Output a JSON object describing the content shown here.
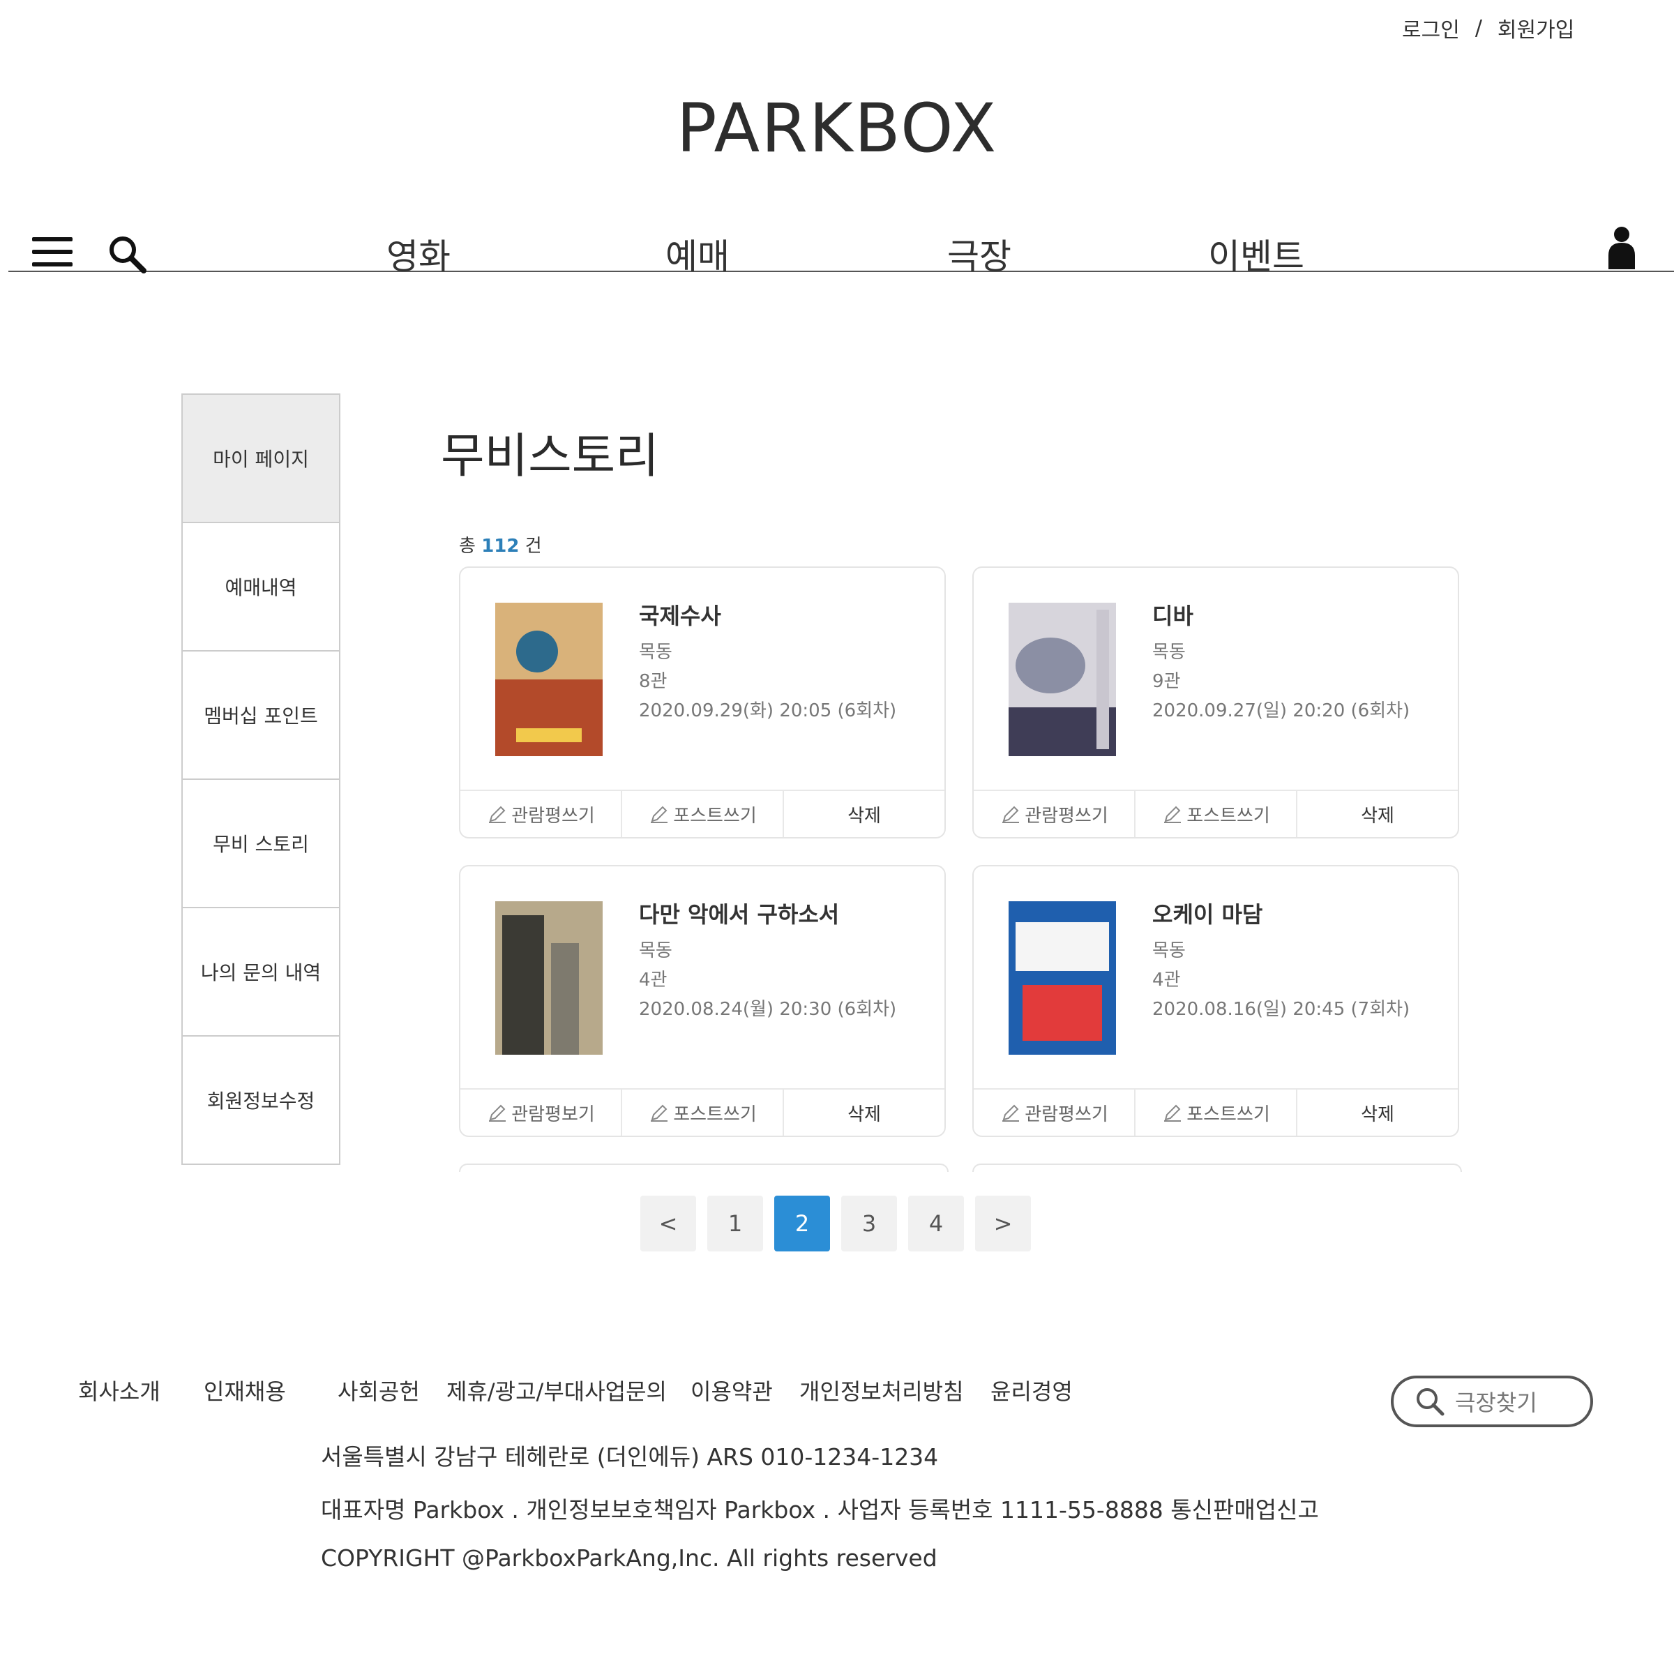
{
  "header": {
    "login": "로그인",
    "separator": "/",
    "signup": "회원가입",
    "logo": "PARKBOX"
  },
  "nav": {
    "items": [
      "영화",
      "예매",
      "극장",
      "이벤트"
    ],
    "icons": {
      "menu": "hamburger-menu-icon",
      "search": "search-icon",
      "user": "user-icon"
    }
  },
  "sidemenu": {
    "items": [
      "마이 페이지",
      "예매내역",
      "멤버십 포인트",
      "무비 스토리",
      "나의 문의 내역",
      "회원정보수정"
    ],
    "active_index": 0
  },
  "main": {
    "title": "무비스토리",
    "count_prefix": "총",
    "count": "112",
    "count_suffix": "건",
    "cards": [
      {
        "title": "국제수사",
        "location": "목동",
        "hall": "8관",
        "datetime": "2020.09.29(화) 20:05 (6회차)",
        "actions": [
          "관람평쓰기",
          "포스트쓰기",
          "삭제"
        ],
        "poster_colors": [
          "#d9b27a",
          "#b34a2a",
          "#2d6a8c"
        ]
      },
      {
        "title": "디바",
        "location": "목동",
        "hall": "9관",
        "datetime": "2020.09.27(일) 20:20 (6회차)",
        "actions": [
          "관람평쓰기",
          "포스트쓰기",
          "삭제"
        ],
        "poster_colors": [
          "#8b8fa4",
          "#3f3d56",
          "#d7d5dc"
        ]
      },
      {
        "title": "다만 악에서 구하소서",
        "location": "목동",
        "hall": "4관",
        "datetime": "2020.08.24(월) 20:30 (6회차)",
        "actions": [
          "관람평보기",
          "포스트쓰기",
          "삭제"
        ],
        "poster_colors": [
          "#7e7a6e",
          "#3b3a34",
          "#b7a98b"
        ]
      },
      {
        "title": "오케이 마담",
        "location": "목동",
        "hall": "4관",
        "datetime": "2020.08.16(일) 20:45 (7회차)",
        "actions": [
          "관람평쓰기",
          "포스트쓰기",
          "삭제"
        ],
        "poster_colors": [
          "#1f5fae",
          "#f5f5f5",
          "#e23b3b"
        ]
      }
    ]
  },
  "pagination": {
    "prev": "<",
    "pages": [
      "1",
      "2",
      "3",
      "4"
    ],
    "current": "2",
    "next": ">"
  },
  "footer": {
    "links": [
      "회사소개",
      "인재채용",
      "사회공헌",
      "제휴/광고/부대사업문의",
      "이용약관",
      "개인정보처리방침",
      "윤리경영"
    ],
    "address": "서울특별시 강남구 테헤란로 (더인에듀) ARS 010-1234-1234",
    "business": "대표자명 Parkbox . 개인정보보호책임자 Parkbox . 사업자 등록번호 1111-55-8888 통신판매업신고",
    "copyright": "COPYRIGHT @ParkboxParkAng,Inc. All rights reserved",
    "theater_search": "극장찾기"
  },
  "colors": {
    "accent": "#2b8ed6",
    "count": "#2c7fb8",
    "active_menu_bg": "#ececec"
  }
}
